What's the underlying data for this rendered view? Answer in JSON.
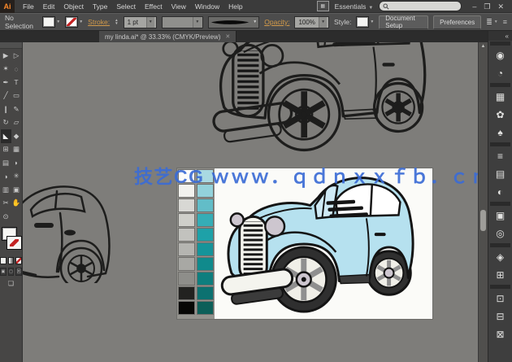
{
  "app": {
    "logo": "Ai"
  },
  "menubar": {
    "menus": [
      "File",
      "Edit",
      "Object",
      "Type",
      "Select",
      "Effect",
      "View",
      "Window",
      "Help"
    ],
    "workspace": "Essentials",
    "search_placeholder": "",
    "window_buttons": {
      "minimize": "–",
      "restore": "❐",
      "close": "✕"
    }
  },
  "controlbar": {
    "no_selection": "No Selection",
    "stroke_label": "Stroke:",
    "stroke_weight": "1 pt",
    "opacity_label": "Opacity:",
    "opacity_value": "100%",
    "style_label": "Style:",
    "document_setup": "Document Setup",
    "preferences": "Preferences"
  },
  "tab": {
    "title": "my linda.ai* @ 33.33% (CMYK/Preview)",
    "close": "✕"
  },
  "toolbar": {
    "tools": [
      {
        "name": "selection-tool",
        "glyph": "▶"
      },
      {
        "name": "direct-selection-tool",
        "glyph": "▷"
      },
      {
        "name": "magic-wand-tool",
        "glyph": "✶"
      },
      {
        "name": "lasso-tool",
        "glyph": "◌"
      },
      {
        "name": "pen-tool",
        "glyph": "✒"
      },
      {
        "name": "type-tool",
        "glyph": "T"
      },
      {
        "name": "line-segment-tool",
        "glyph": "╱"
      },
      {
        "name": "rectangle-tool",
        "glyph": "▭"
      },
      {
        "name": "paintbrush-tool",
        "glyph": "❙"
      },
      {
        "name": "pencil-tool",
        "glyph": "✎"
      },
      {
        "name": "rotate-tool",
        "glyph": "↻"
      },
      {
        "name": "scale-tool",
        "glyph": "▱"
      },
      {
        "name": "width-tool",
        "glyph": "◣",
        "active": true
      },
      {
        "name": "shape-builder-tool",
        "glyph": "◆"
      },
      {
        "name": "perspective-grid-tool",
        "glyph": "⊞"
      },
      {
        "name": "mesh-tool",
        "glyph": "▦"
      },
      {
        "name": "gradient-tool",
        "glyph": "▤"
      },
      {
        "name": "eyedropper-tool",
        "glyph": "◗"
      },
      {
        "name": "blend-tool",
        "glyph": "◑"
      },
      {
        "name": "symbol-sprayer-tool",
        "glyph": "✳"
      },
      {
        "name": "column-graph-tool",
        "glyph": "▥"
      },
      {
        "name": "artboard-tool",
        "glyph": "▣"
      },
      {
        "name": "slice-tool",
        "glyph": "✂"
      },
      {
        "name": "hand-tool",
        "glyph": "✋"
      },
      {
        "name": "zoom-tool",
        "glyph": "⊙"
      },
      {
        "name": "blank",
        "glyph": ""
      }
    ]
  },
  "dock": {
    "expand_glyph": "«",
    "groups": [
      [
        {
          "name": "color-panel",
          "glyph": "◉"
        },
        {
          "name": "color-guide-panel",
          "glyph": "◔"
        }
      ],
      [
        {
          "name": "swatches-panel",
          "glyph": "▦"
        },
        {
          "name": "brushes-panel",
          "glyph": "✿"
        },
        {
          "name": "symbols-panel",
          "glyph": "♠"
        }
      ],
      [
        {
          "name": "stroke-panel",
          "glyph": "≡"
        },
        {
          "name": "gradient-panel",
          "glyph": "▤"
        },
        {
          "name": "transparency-panel",
          "glyph": "◐"
        }
      ],
      [
        {
          "name": "graphic-styles-panel",
          "glyph": "▣"
        },
        {
          "name": "appearance-panel",
          "glyph": "◎"
        }
      ],
      [
        {
          "name": "layers-panel",
          "glyph": "◈"
        },
        {
          "name": "artboards-panel",
          "glyph": "⊞"
        }
      ],
      [
        {
          "name": "transform-panel",
          "glyph": "⊡"
        },
        {
          "name": "align-panel",
          "glyph": "⊟"
        },
        {
          "name": "pathfinder-panel",
          "glyph": "⊠"
        }
      ]
    ]
  },
  "watermark": {
    "text": "技艺CG ｗｗｗ．ｑｄｎｘｘｆｂ．ｃｎ"
  },
  "artwork": {
    "swatches": {
      "gray": [
        "#fcfcfa",
        "#f2f2ee",
        "#d8d8d4",
        "#cfcfca",
        "#c2c2be",
        "#b5b5b1",
        "#a8a8a4",
        "#8e8e8a",
        "#222220",
        "#070705"
      ],
      "teal": [
        "#a9d9e2",
        "#93d2db",
        "#62bdc8",
        "#35adb6",
        "#1ea1a8",
        "#15949a",
        "#108a8c",
        "#0e7e7e",
        "#0c7170",
        "#0c5f59"
      ]
    }
  },
  "colors": {
    "canvas": "#7e7d7a",
    "watermark_blue": "#3b6cd6",
    "car_body": "#b6e1ef",
    "car_glass": "#cfeaf5",
    "ink": "#141414"
  }
}
